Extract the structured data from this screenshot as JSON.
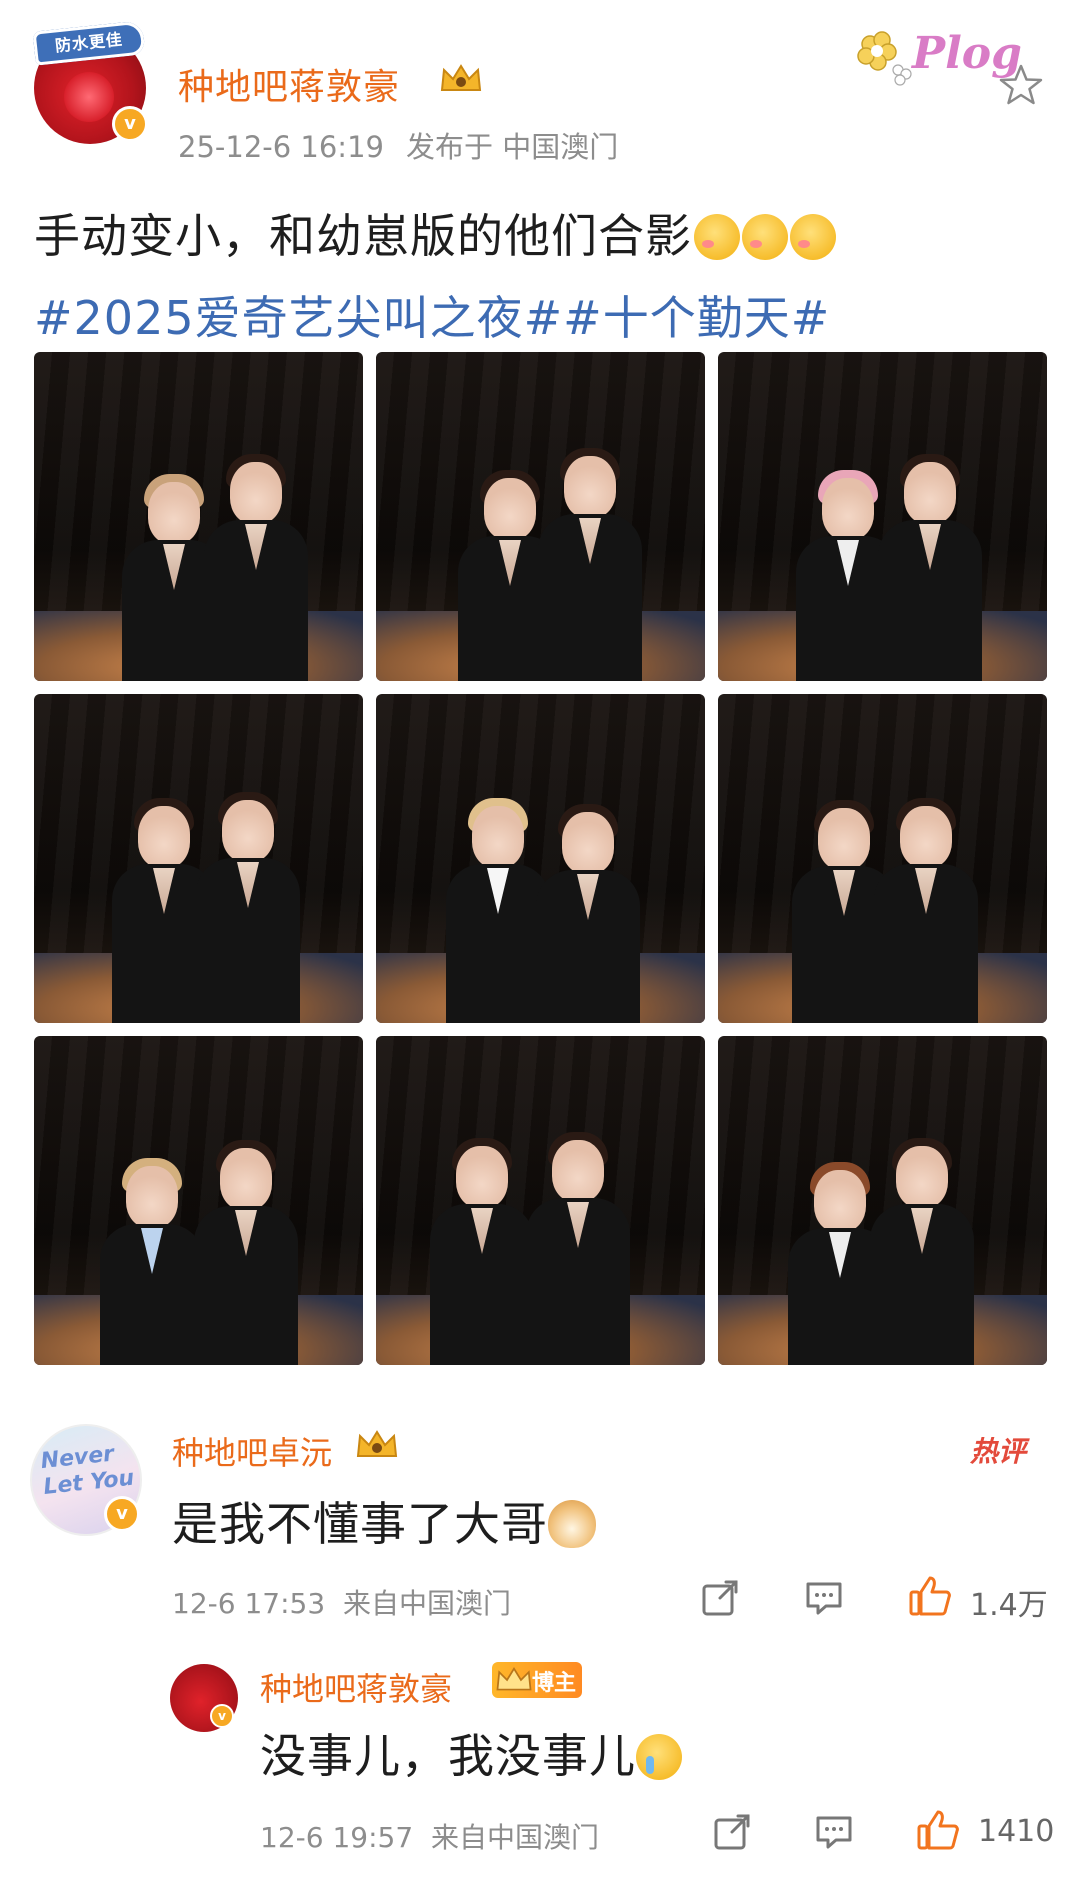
{
  "post": {
    "author_name": "种地吧蒋敦豪",
    "avatar_pendant_text": "防水更佳",
    "time": "25-12-6 16:19",
    "location": "发布于 中国澳门",
    "plog_label": "Plog",
    "text": "手动变小，和幼崽版的他们合影",
    "hashtags": [
      "#2025爱奇艺尖叫之夜#",
      "#十个勤天#"
    ],
    "photo_count": 9
  },
  "comments": [
    {
      "user": "种地吧卓沅",
      "avatar_text": "Never Let You",
      "badge": "热评",
      "text": "是我不懂事了大哥",
      "time": "12-6 17:53",
      "location": "来自中国澳门",
      "likes": "1.4万"
    },
    {
      "user": "种地吧蒋敦豪",
      "badge": "博主",
      "text": "没事儿，我没事儿",
      "time": "12-6 19:57",
      "location": "来自中国澳门",
      "likes": "1410"
    }
  ],
  "colors": {
    "name_orange": "#ea6a1a",
    "hashtag_blue": "#3d6bb3",
    "meta_gray": "#8d8d8d",
    "like_orange": "#f2741e",
    "hot_red": "#e34a3b"
  },
  "icons": [
    "star-icon",
    "share-icon",
    "comment-icon",
    "like-icon",
    "crown-icon",
    "verified-icon"
  ]
}
